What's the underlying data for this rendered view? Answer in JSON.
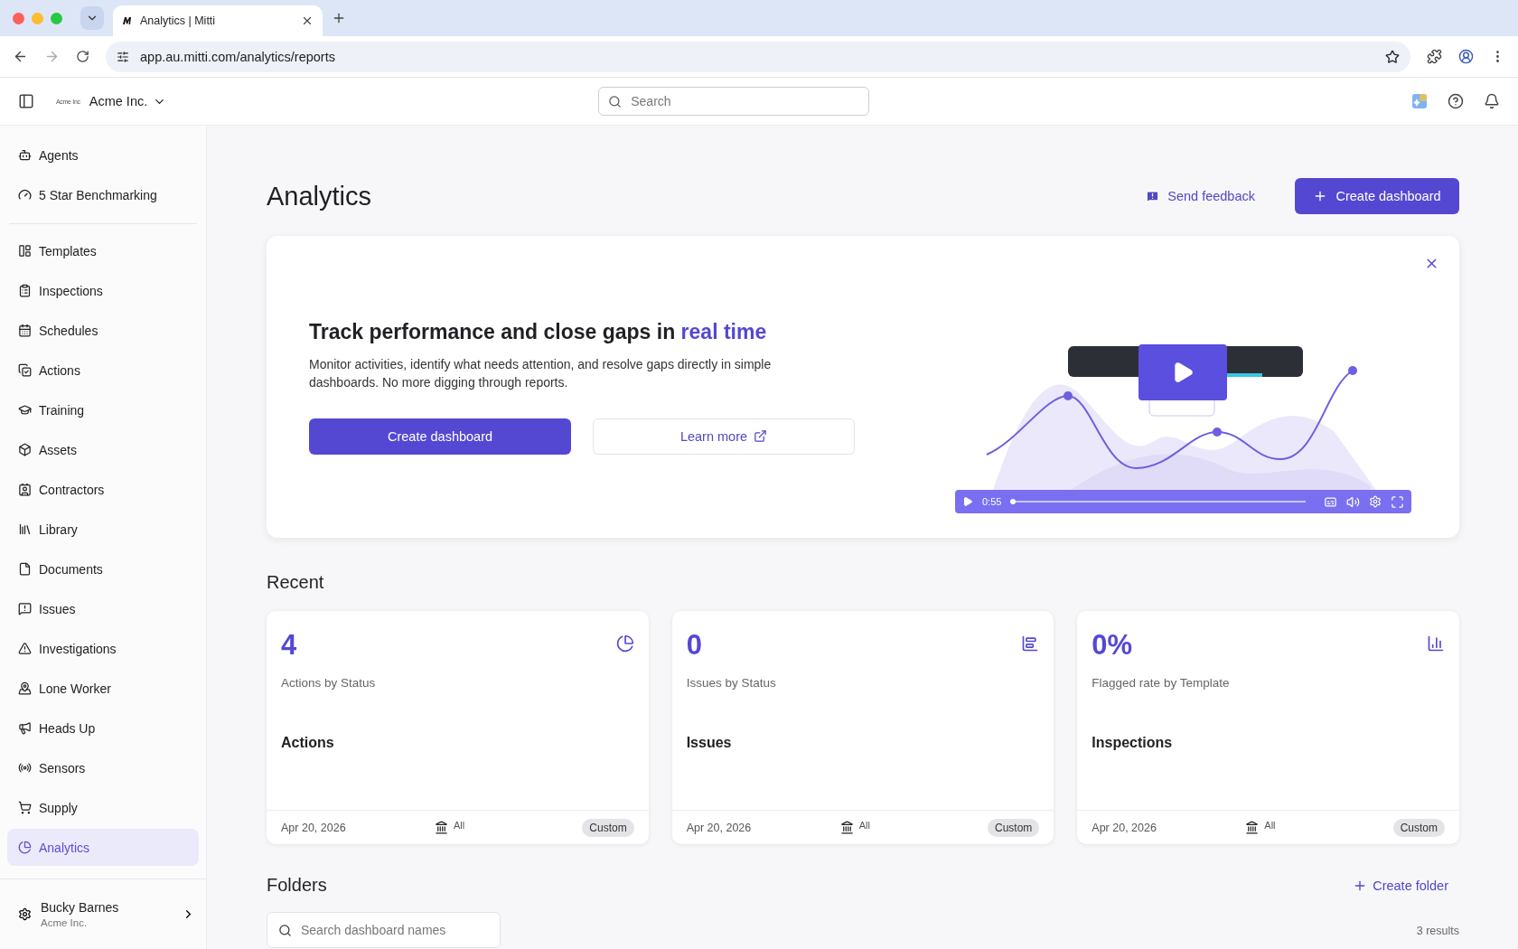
{
  "browser": {
    "tabs": [
      {
        "title": "Analytics | Mitti",
        "selected": true
      }
    ],
    "address": "app.au.mitti.com/analytics/reports"
  },
  "header": {
    "org_logo": "Acme Inc",
    "org": "Acme Inc.",
    "search_placeholder": "Search"
  },
  "sidebar": {
    "groups": [
      [
        {
          "label": "Agents",
          "selected": false
        },
        {
          "label": "5 Star Benchmarking",
          "selected": false
        }
      ],
      [
        {
          "label": "Templates",
          "selected": false
        },
        {
          "label": "Inspections",
          "selected": false
        },
        {
          "label": "Schedules",
          "selected": false
        },
        {
          "label": "Actions",
          "selected": false
        },
        {
          "label": "Training",
          "selected": false
        },
        {
          "label": "Assets",
          "selected": false
        },
        {
          "label": "Contractors",
          "selected": false
        },
        {
          "label": "Library",
          "selected": false
        },
        {
          "label": "Documents",
          "selected": false
        },
        {
          "label": "Issues",
          "selected": false
        },
        {
          "label": "Investigations",
          "selected": false
        },
        {
          "label": "Lone Worker",
          "selected": false
        },
        {
          "label": "Heads Up",
          "selected": false
        },
        {
          "label": "Sensors",
          "selected": false
        },
        {
          "label": "Supply",
          "selected": false
        },
        {
          "label": "Analytics",
          "selected": true
        }
      ]
    ],
    "user": {
      "name": "Bucky Barnes",
      "org": "Acme Inc."
    }
  },
  "page": {
    "title": "Analytics",
    "send_feedback": "Send feedback",
    "create_dashboard": "Create dashboard"
  },
  "banner": {
    "heading": "Track performance and close gaps in",
    "heading_accent": "real time",
    "body": "Monitor activities, identify what needs attention, and resolve gaps directly in simple dashboards. No more digging through reports.",
    "primary_button": "Create dashboard",
    "secondary_button": "Learn more",
    "video": {
      "kind": "picture",
      "time": "0:55"
    }
  },
  "recent": {
    "title": "Recent",
    "cards": [
      {
        "value": "4",
        "subtitle": "Actions by Status",
        "module": "Actions",
        "date": "Apr 20, 2026",
        "scope": "All",
        "tag": "Custom"
      },
      {
        "value": "0",
        "subtitle": "Issues by Status",
        "module": "Issues",
        "date": "Apr 20, 2026",
        "scope": "All",
        "tag": "Custom"
      },
      {
        "value": "0%",
        "subtitle": "Flagged rate by Template",
        "module": "Inspections",
        "date": "Apr 20, 2026",
        "scope": "All",
        "tag": "Custom"
      }
    ]
  },
  "folders": {
    "title": "Folders",
    "create": "Create folder",
    "search_placeholder": "Search dashboard names",
    "results": "3 results"
  }
}
